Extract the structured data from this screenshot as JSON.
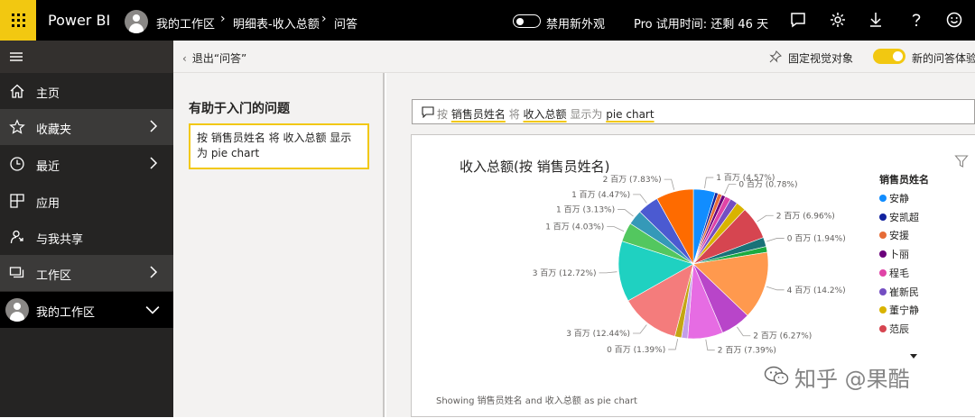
{
  "topbar": {
    "app_name": "Power BI",
    "breadcrumb": [
      "我的工作区",
      "明细表-收入总额",
      "问答"
    ],
    "new_look_label": "禁用新外观",
    "trial_text": "Pro 试用时间: 还剩 46 天"
  },
  "sidebar": {
    "items": [
      {
        "label": "主页",
        "icon": "home-icon"
      },
      {
        "label": "收藏夹",
        "icon": "star-icon"
      },
      {
        "label": "最近",
        "icon": "clock-icon"
      },
      {
        "label": "应用",
        "icon": "apps-icon"
      },
      {
        "label": "与我共享",
        "icon": "share-person-icon"
      },
      {
        "label": "工作区",
        "icon": "workspace-icon"
      },
      {
        "label": "我的工作区",
        "icon": "avatar"
      }
    ]
  },
  "subbar": {
    "exit_label": "退出“问答”",
    "pin_label": "固定视觉对象",
    "new_qa_label": "新的问答体验"
  },
  "qa_panel": {
    "title": "有助于入门的问题",
    "suggestion": "按 销售员姓名 将 收入总额 显示为 pie chart"
  },
  "question": {
    "w1": "按",
    "t1": "销售员姓名",
    "w2": "将",
    "t2": "收入总额",
    "w3": "显示为",
    "t3": "pie chart"
  },
  "legend": {
    "title": "销售员姓名",
    "items": [
      {
        "name": "安静",
        "color": "#118dff"
      },
      {
        "name": "安凯超",
        "color": "#12239e"
      },
      {
        "name": "安援",
        "color": "#e66c37"
      },
      {
        "name": "卜丽",
        "color": "#6b007b"
      },
      {
        "name": "程毛",
        "color": "#e044a7"
      },
      {
        "name": "崔新民",
        "color": "#744ec2"
      },
      {
        "name": "董宁静",
        "color": "#d9b300"
      },
      {
        "name": "范辰",
        "color": "#d64550"
      }
    ]
  },
  "showing_text": "Showing 销售员姓名 and 收入总额 as pie chart",
  "watermark": "知乎 @果酷",
  "chart_data": {
    "type": "pie",
    "title": "收入总额(按 销售员姓名)",
    "slices": [
      {
        "label": "1 百万 (4.57%)",
        "value": 4.57,
        "color": "#118dff"
      },
      {
        "label": "",
        "value": 0.65,
        "color": "#12239e"
      },
      {
        "label": "",
        "value": 0.85,
        "color": "#e66c37"
      },
      {
        "label": "0 百万 (0.78%)",
        "value": 0.78,
        "color": "#6b007b"
      },
      {
        "label": "",
        "value": 1.2,
        "color": "#e044a7"
      },
      {
        "label": "",
        "value": 1.55,
        "color": "#744ec2"
      },
      {
        "label": "",
        "value": 2.1,
        "color": "#d9b300"
      },
      {
        "label": "2 百万 (6.96%)",
        "value": 6.96,
        "color": "#d64550"
      },
      {
        "label": "0 百万 (1.94%)",
        "value": 1.94,
        "color": "#197278"
      },
      {
        "label": "",
        "value": 1.2,
        "color": "#1aab40"
      },
      {
        "label": "4 百万 (14.2%)",
        "value": 14.2,
        "color": "#ff994e"
      },
      {
        "label": "2 百万 (6.27%)",
        "value": 6.27,
        "color": "#b845c9"
      },
      {
        "label": "2 百万 (7.39%)",
        "value": 7.39,
        "color": "#e66ce3"
      },
      {
        "label": "",
        "value": 1.3,
        "color": "#c39ee9"
      },
      {
        "label": "0 百万 (1.39%)",
        "value": 1.39,
        "color": "#c4a613"
      },
      {
        "label": "3 百万 (12.44%)",
        "value": 12.44,
        "color": "#f47c7c"
      },
      {
        "label": "3 百万 (12.72%)",
        "value": 12.72,
        "color": "#1fd1c1"
      },
      {
        "label": "1 百万 (4.03%)",
        "value": 4.03,
        "color": "#53c75f"
      },
      {
        "label": "1 百万 (3.13%)",
        "value": 3.13,
        "color": "#3599b8"
      },
      {
        "label": "1 百万 (4.47%)",
        "value": 4.47,
        "color": "#4b5ad1"
      },
      {
        "label": "2 百万 (7.83%)",
        "value": 7.83,
        "color": "#fe6b00"
      }
    ]
  }
}
